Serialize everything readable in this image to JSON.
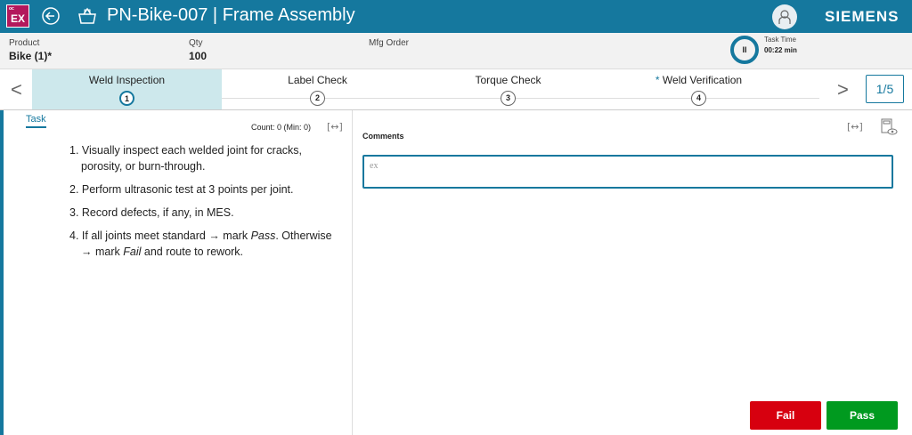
{
  "header": {
    "logo_top": "oc",
    "logo": "EX",
    "title": "PN-Bike-007 | Frame Assembly",
    "brand": "SIEMENS",
    "icons": [
      "back-icon",
      "basket-icon",
      "user-icon"
    ]
  },
  "info": {
    "product_label": "Product",
    "product_value": "Bike (1)*",
    "qty_label": "Qty",
    "qty_value": "100",
    "mfg_label": "Mfg Order",
    "task_time_label": "Task Time",
    "task_time_value": "00:22 min",
    "pause_symbol": "II"
  },
  "steps": [
    {
      "name": "Weld Inspection",
      "num": "1",
      "active": true
    },
    {
      "name": "Label Check",
      "num": "2"
    },
    {
      "name": "Torque Check",
      "num": "3"
    },
    {
      "name": "Weld Verification",
      "num": "4",
      "required_mark": "*"
    }
  ],
  "pager": "1/5",
  "task": {
    "tab": "Task",
    "count": "Count: 0 (Min: 0)",
    "items": [
      "1. Visually inspect each welded joint for cracks, porosity, or burn-through.",
      "2. Perform ultrasonic test at 3 points per joint.",
      "3. Record defects, if any, in MES."
    ],
    "item4_a": "4. If all joints meet standard → mark ",
    "item4_pass": "Pass",
    "item4_b": ". Otherwise → mark ",
    "item4_fail": "Fail",
    "item4_c": " and route to rework."
  },
  "comments": {
    "label": "Comments",
    "value": "ex"
  },
  "actions": {
    "fail": "Fail",
    "pass": "Pass"
  },
  "colors": {
    "primary": "#15789e",
    "fail": "#d7000f",
    "pass": "#009a1f",
    "logo": "#b3185c"
  }
}
